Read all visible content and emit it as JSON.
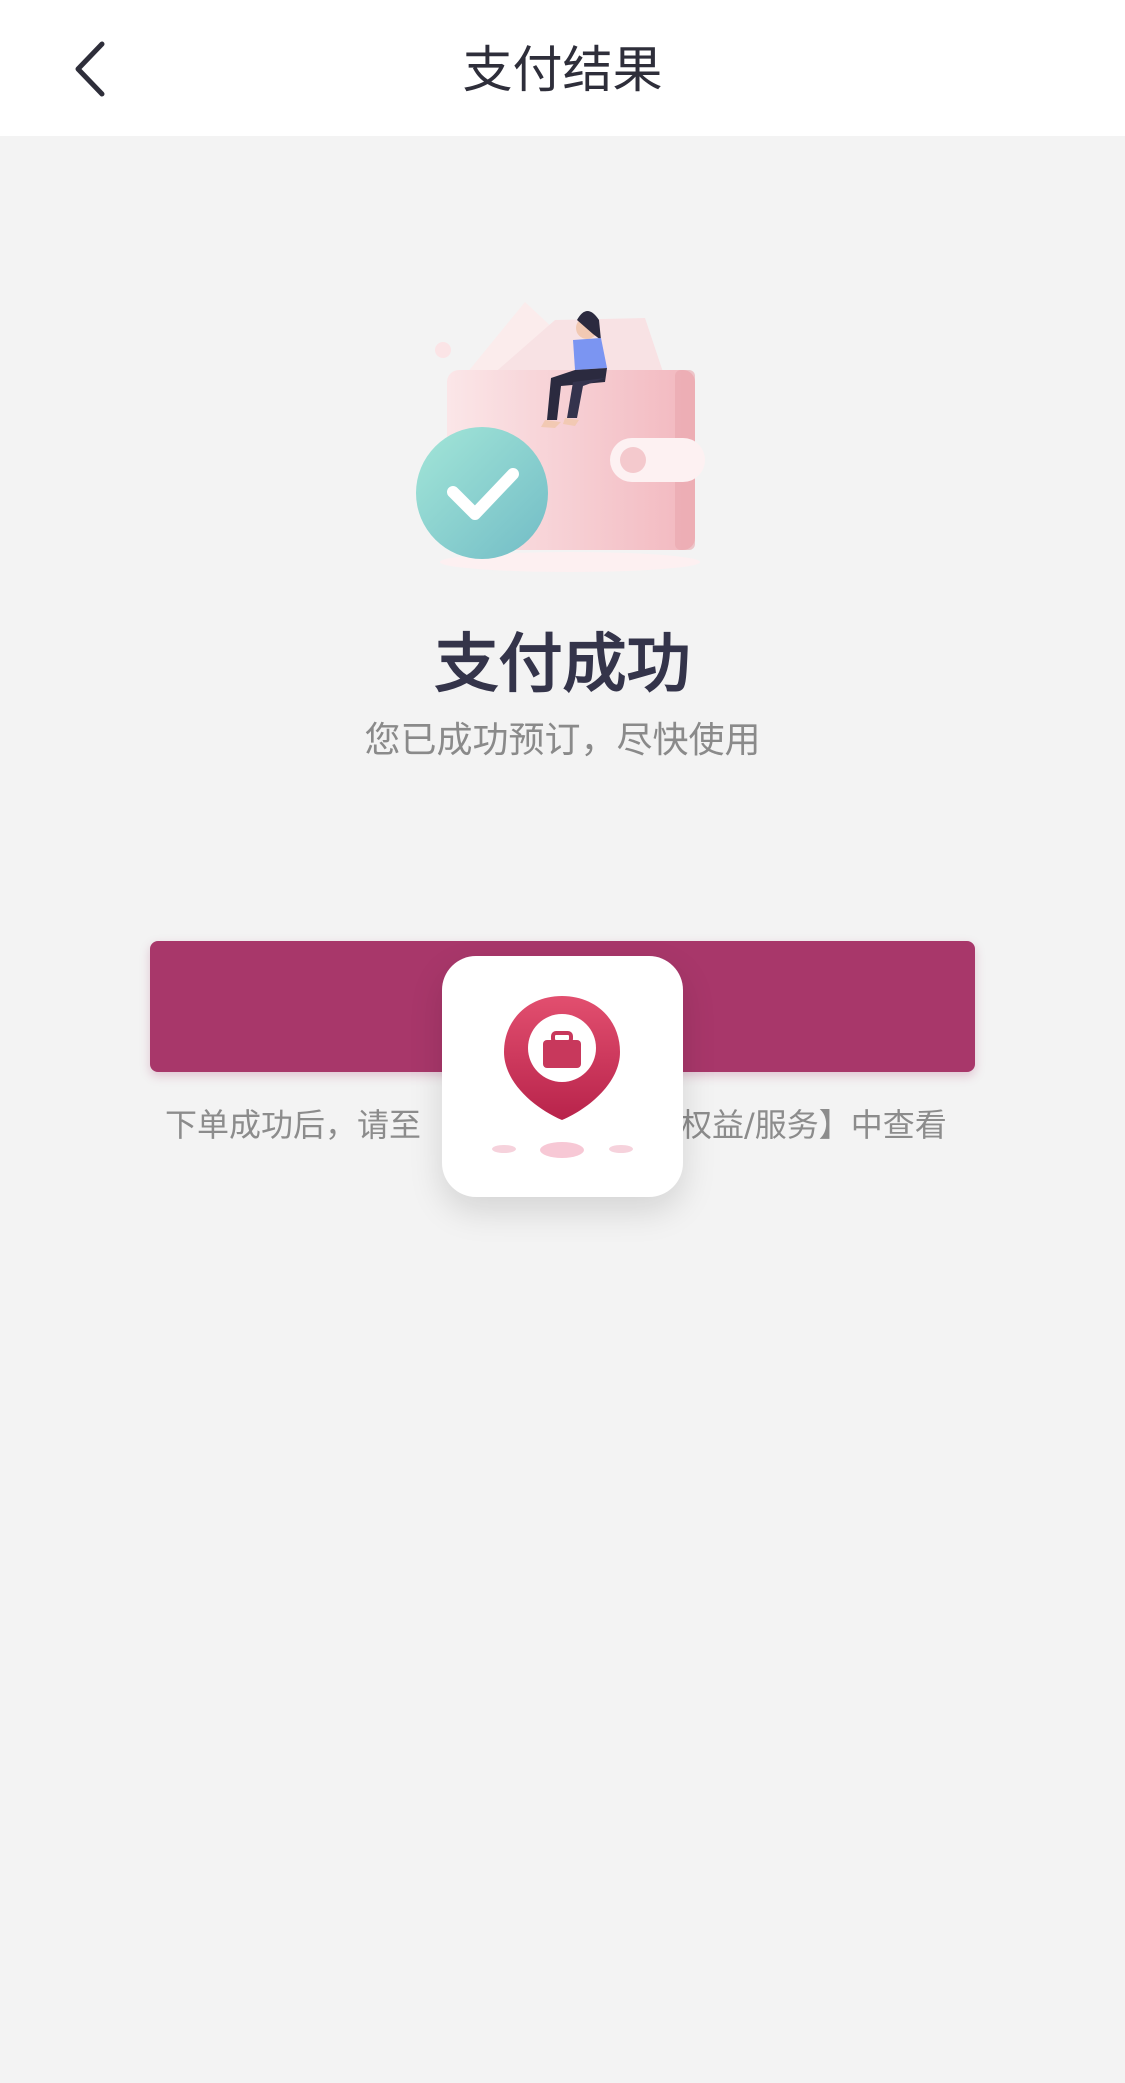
{
  "header": {
    "title": "支付结果",
    "back_icon": "chevron-left-icon"
  },
  "result": {
    "title": "支付成功",
    "subtitle": "您已成功预订，尽快使用",
    "illustration": "wallet-success-illustration",
    "check_icon": "check-circle-icon"
  },
  "action": {
    "button_label": "",
    "button_color": "#a8376a"
  },
  "hint": {
    "left_text": "下单成功后，请至",
    "right_text": "权益/服务】中查看"
  },
  "overlay": {
    "icon": "location-briefcase-icon",
    "accent_color": "#c8385c"
  }
}
